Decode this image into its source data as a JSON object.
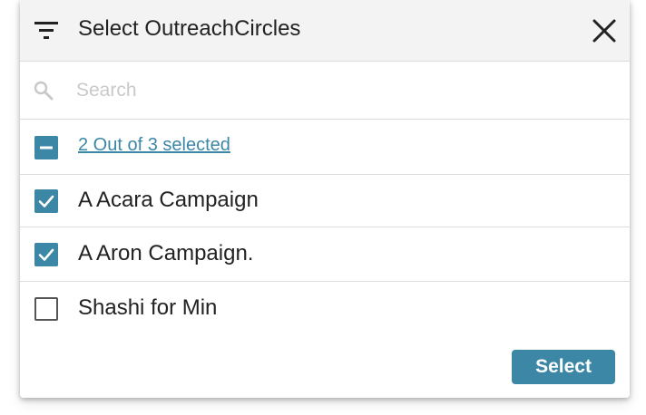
{
  "dialog": {
    "title": "Select OutreachCircles",
    "filter_icon": "filter-icon",
    "close_icon": "close-icon"
  },
  "search": {
    "placeholder": "Search",
    "value": "",
    "icon": "search-icon"
  },
  "summary": {
    "text": "2 Out of 3 selected",
    "state": "indeterminate"
  },
  "items": [
    {
      "label": "A Acara Campaign",
      "checked": true
    },
    {
      "label": "A Aron Campaign.",
      "checked": true
    },
    {
      "label": "Shashi for Min",
      "checked": false
    }
  ],
  "footer": {
    "select_label": "Select"
  },
  "colors": {
    "accent": "#3b87a5",
    "header_bg": "#f3f3f3",
    "divider": "#dcdcdc",
    "placeholder": "#c9c9c9"
  }
}
